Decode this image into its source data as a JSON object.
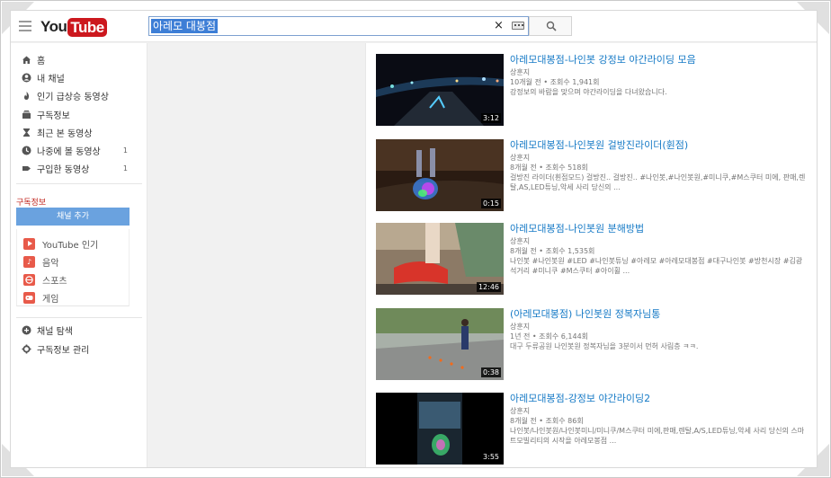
{
  "search": {
    "query": "아레모 대봉점",
    "clear": "×"
  },
  "logo": {
    "you": "You",
    "tube": "Tube"
  },
  "guide": {
    "items": [
      {
        "label": "홈",
        "icon": "home-icon"
      },
      {
        "label": "내 채널",
        "icon": "person-icon"
      },
      {
        "label": "인기 급상승 동영상",
        "icon": "flame-icon"
      },
      {
        "label": "구독정보",
        "icon": "subscriptions-icon"
      },
      {
        "label": "최근 본 동영상",
        "icon": "hourglass-icon"
      },
      {
        "label": "나중에 볼 동영상",
        "icon": "clock-icon",
        "count": "1"
      },
      {
        "label": "구입한 동영상",
        "icon": "tag-icon",
        "count": "1"
      }
    ],
    "section_title": "구독정보",
    "add_channel": "채널 추가",
    "subscriptions": [
      {
        "label": "YouTube 인기",
        "icon": "play-icon",
        "color": "#e85a4a"
      },
      {
        "label": "음악",
        "icon": "music-icon",
        "color": "#e86a4a"
      },
      {
        "label": "스포츠",
        "icon": "sports-icon",
        "color": "#e85a4a"
      },
      {
        "label": "게임",
        "icon": "gamepad-icon",
        "color": "#e85a4a"
      }
    ],
    "footer": [
      {
        "label": "채널 탐색",
        "icon": "plus-circle-icon"
      },
      {
        "label": "구독정보 관리",
        "icon": "gear-icon"
      }
    ]
  },
  "videos": [
    {
      "title": "아레모대봉점-나인봇 강정보 야간라이딩 모음",
      "channel": "상훈지",
      "meta": "10개월 전 • 조회수 1,941회",
      "desc": "강정보의 바람을 맞으며 야간라이딩을 다녀왔습니다.",
      "duration": "3:12"
    },
    {
      "title": "아레모대봉점-나인봇원 걸방진라이더(휜점)",
      "channel": "상훈지",
      "meta": "8개월 전 • 조회수 518회",
      "desc": "걸방진 라이더(휜점모드) 걸방진.. 걸방진.. #나인봇,#나인봇원,#미니쿠,#M스쿠터 미에, 판매,렌탈,AS,LED튜닝,악세 사리 당신의 ...",
      "duration": "0:15"
    },
    {
      "title": "아레모대봉점-나인봇원 분해방법",
      "channel": "상훈지",
      "meta": "8개월 전 • 조회수 1,535회",
      "desc": "나인봇 #나인봇원 #LED #나인봇튜닝 #아레모 #아레모대봉점 #대구나인봇 #방천시장 #김광석거리 #미니쿠 #M스쿠터 #아이휠 ...",
      "duration": "12:46"
    },
    {
      "title": "(아레모대봉점) 나인봇원 정복자님통",
      "channel": "상훈지",
      "meta": "1년 전 • 조회수 6,144회",
      "desc": "대구 두류공원 나인봇원 정복자님을 3분이서 먼허 사림층 ㅋㅋ.",
      "duration": "0:38"
    },
    {
      "title": "아레모대봉점-강정보 야간라이딩2",
      "channel": "상훈지",
      "meta": "8개월 전 • 조회수 86회",
      "desc": "나인봇/나인봇원/나인봇미니/미니쿠/M스쿠터 미에,판매,렌탈,A/S,LED튜닝,악세 사리 당신의 스마트모빌리티의 시작을 아레모봉점 ...",
      "duration": "3:55"
    }
  ]
}
